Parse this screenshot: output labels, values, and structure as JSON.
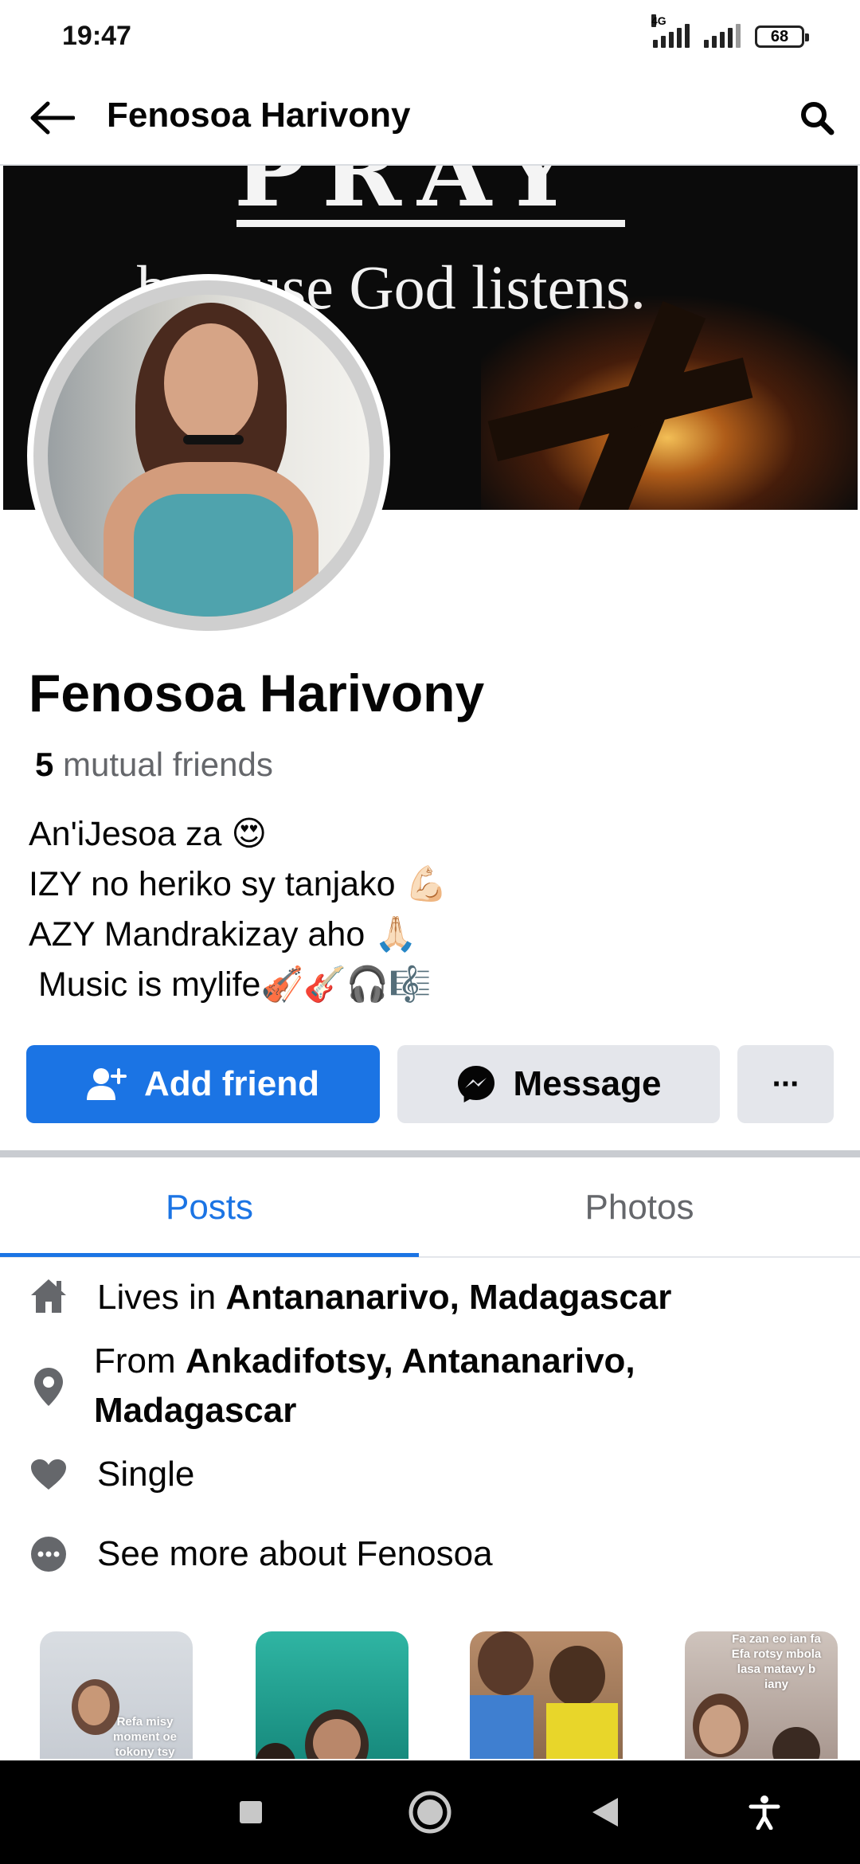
{
  "status_bar": {
    "time": "19:47",
    "network_type": "4G",
    "battery": "68"
  },
  "header": {
    "title": "Fenosoa Harivony",
    "back_icon": "arrow-left-icon",
    "search_icon": "search-icon"
  },
  "cover": {
    "text": "because God listens.",
    "top_letters": "PRAY"
  },
  "profile": {
    "name": "Fenosoa Harivony",
    "mutual_count": "5",
    "mutual_label": "mutual friends",
    "bio": [
      "An'iJesoa za 😍",
      "IZY no heriko sy tanjako 💪🏻",
      "AZY Mandrakizay aho 🙏🏻",
      " Music is mylife🎻🎸🎧🎼"
    ]
  },
  "actions": {
    "add_friend": "Add friend",
    "message": "Message",
    "more": "···"
  },
  "tabs": [
    {
      "label": "Posts",
      "active": true
    },
    {
      "label": "Photos",
      "active": false
    }
  ],
  "details": {
    "lives": {
      "prefix": "Lives in ",
      "value": "Antananarivo, Madagascar"
    },
    "from": {
      "prefix": "From ",
      "value_line1": "Ankadifotsy, Antananarivo,",
      "value_line2": "Madagascar"
    },
    "relationship": "Single",
    "see_more": "See more about Fenosoa"
  },
  "stories": [
    {
      "text": "Refa misy moment oe tokony tsy"
    },
    {
      "text": ""
    },
    {
      "text": ""
    },
    {
      "text": "Fa zan eo ian fa Efa rotsy mbola lasa matavy b iany"
    }
  ],
  "accent_colors": {
    "primary": "#1b74e4",
    "secondary_button": "#e4e6eb",
    "muted_text": "#65676b"
  }
}
